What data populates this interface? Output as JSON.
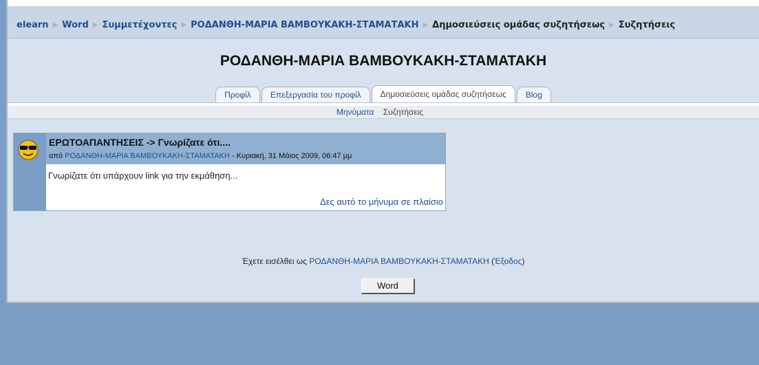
{
  "breadcrumb": {
    "items": [
      "elearn",
      "Word",
      "Συμμετέχοντες",
      "ΡΟΔΑΝΘΗ-ΜΑΡΙΑ ΒΑΜΒΟΥΚΑΚΗ-ΣΤΑΜΑΤΑΚΗ",
      "Δημοσιεύσεις ομάδας συζητήσεως",
      "Συζητήσεις"
    ]
  },
  "page_title": "ΡΟΔΑΝΘΗ-ΜΑΡΙΑ ΒΑΜΒΟΥΚΑΚΗ-ΣΤΑΜΑΤΑΚΗ",
  "tabs": [
    {
      "label": "Προφίλ"
    },
    {
      "label": "Επεξεργασία του προφίλ"
    },
    {
      "label": "Δημοσιεύσεις ομάδας συζητήσεως",
      "selected": true
    },
    {
      "label": "Blog"
    }
  ],
  "subtabs": [
    {
      "label": "Μηνύματα"
    },
    {
      "label": "Συζητήσεις",
      "selected": true
    }
  ],
  "post": {
    "subject": "ΕΡΩΤΟΑΠΑΝΤΗΣΕΙΣ -> Γνωρίζατε ότι....",
    "by_label": "από",
    "author": "ΡΟΔΑΝΘΗ-ΜΑΡΙΑ ΒΑΜΒΟΥΚΑΚΗ-ΣΤΑΜΑΤΑΚΗ",
    "date": " - Κυριακή, 31 Μάιος 2009, 06:47 μμ",
    "body": "Γνωρίζατε ότι υπάρχουν link για την εκμάθηση...",
    "link": "Δες αυτό το μήνυμα σε πλαίσιο",
    "avatar_icon": "sunglasses-smiley-icon"
  },
  "footer": {
    "login_prefix": "Έχετε εισέλθει ως",
    "login_user": "ΡΟΔΑΝΘΗ-ΜΑΡΙΑ ΒΑΜΒΟΥΚΑΚΗ-ΣΤΑΜΑΤΑΚΗ",
    "logout_open": "(",
    "logout": "Έξοδος",
    "logout_close": ")",
    "home_button": "Word"
  },
  "colors": {
    "outer_background": "#7a9ec6",
    "page_background": "#d7e2ee",
    "link": "#1f4f8c",
    "post_header": "#8fb0d0"
  }
}
